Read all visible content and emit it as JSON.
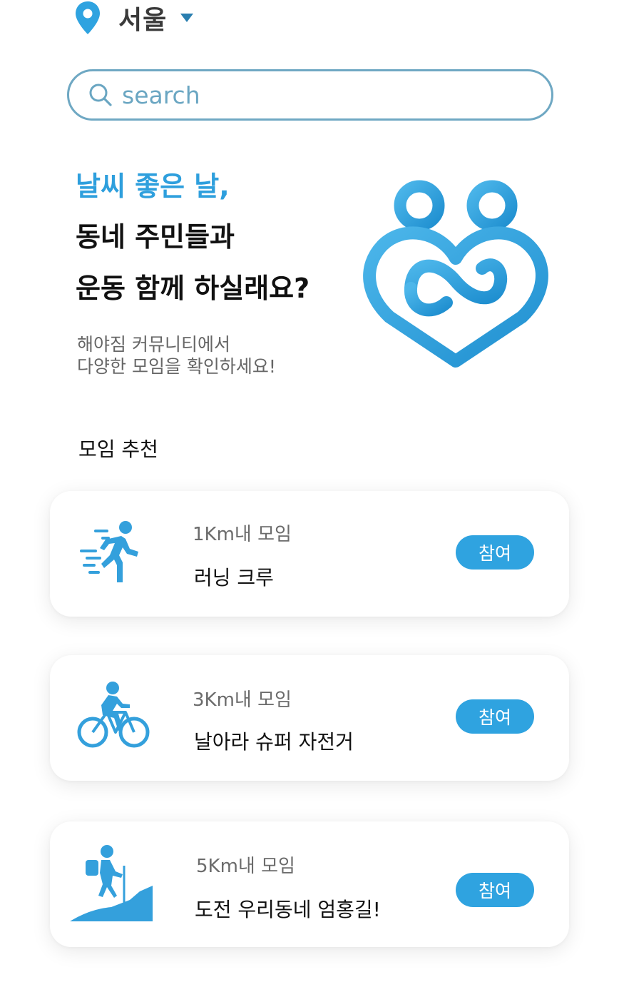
{
  "header": {
    "location": "서울",
    "location_icon": "map-pin-icon",
    "dropdown_icon": "caret-down-icon"
  },
  "search": {
    "placeholder": "search",
    "icon": "search-icon"
  },
  "hero": {
    "line1": "날씨 좋은 날,",
    "line2": "동네 주민들과",
    "line3": "운동 함께 하실래요?",
    "sub_line1": "해야짐 커뮤니티에서",
    "sub_line2": "다양한 모임을 확인하세요!",
    "logo_icon": "heart-people-logo"
  },
  "section": {
    "title": "모임 추천"
  },
  "groups": [
    {
      "icon": "running-icon",
      "distance": "1Km내 모임",
      "name": "러닝 크루",
      "button": "참여"
    },
    {
      "icon": "cycling-icon",
      "distance": "3Km내 모임",
      "name": "날아라 슈퍼 자전거",
      "button": "참여"
    },
    {
      "icon": "hiking-icon",
      "distance": "5Km내 모임",
      "name": "도전 우리동네 엄홍길!",
      "button": "참여"
    }
  ],
  "colors": {
    "accent": "#2fa3e0",
    "search_border": "#6fa8c3",
    "hero_highlight": "#2e9fdd",
    "icon_blue": "#34a0dc"
  }
}
